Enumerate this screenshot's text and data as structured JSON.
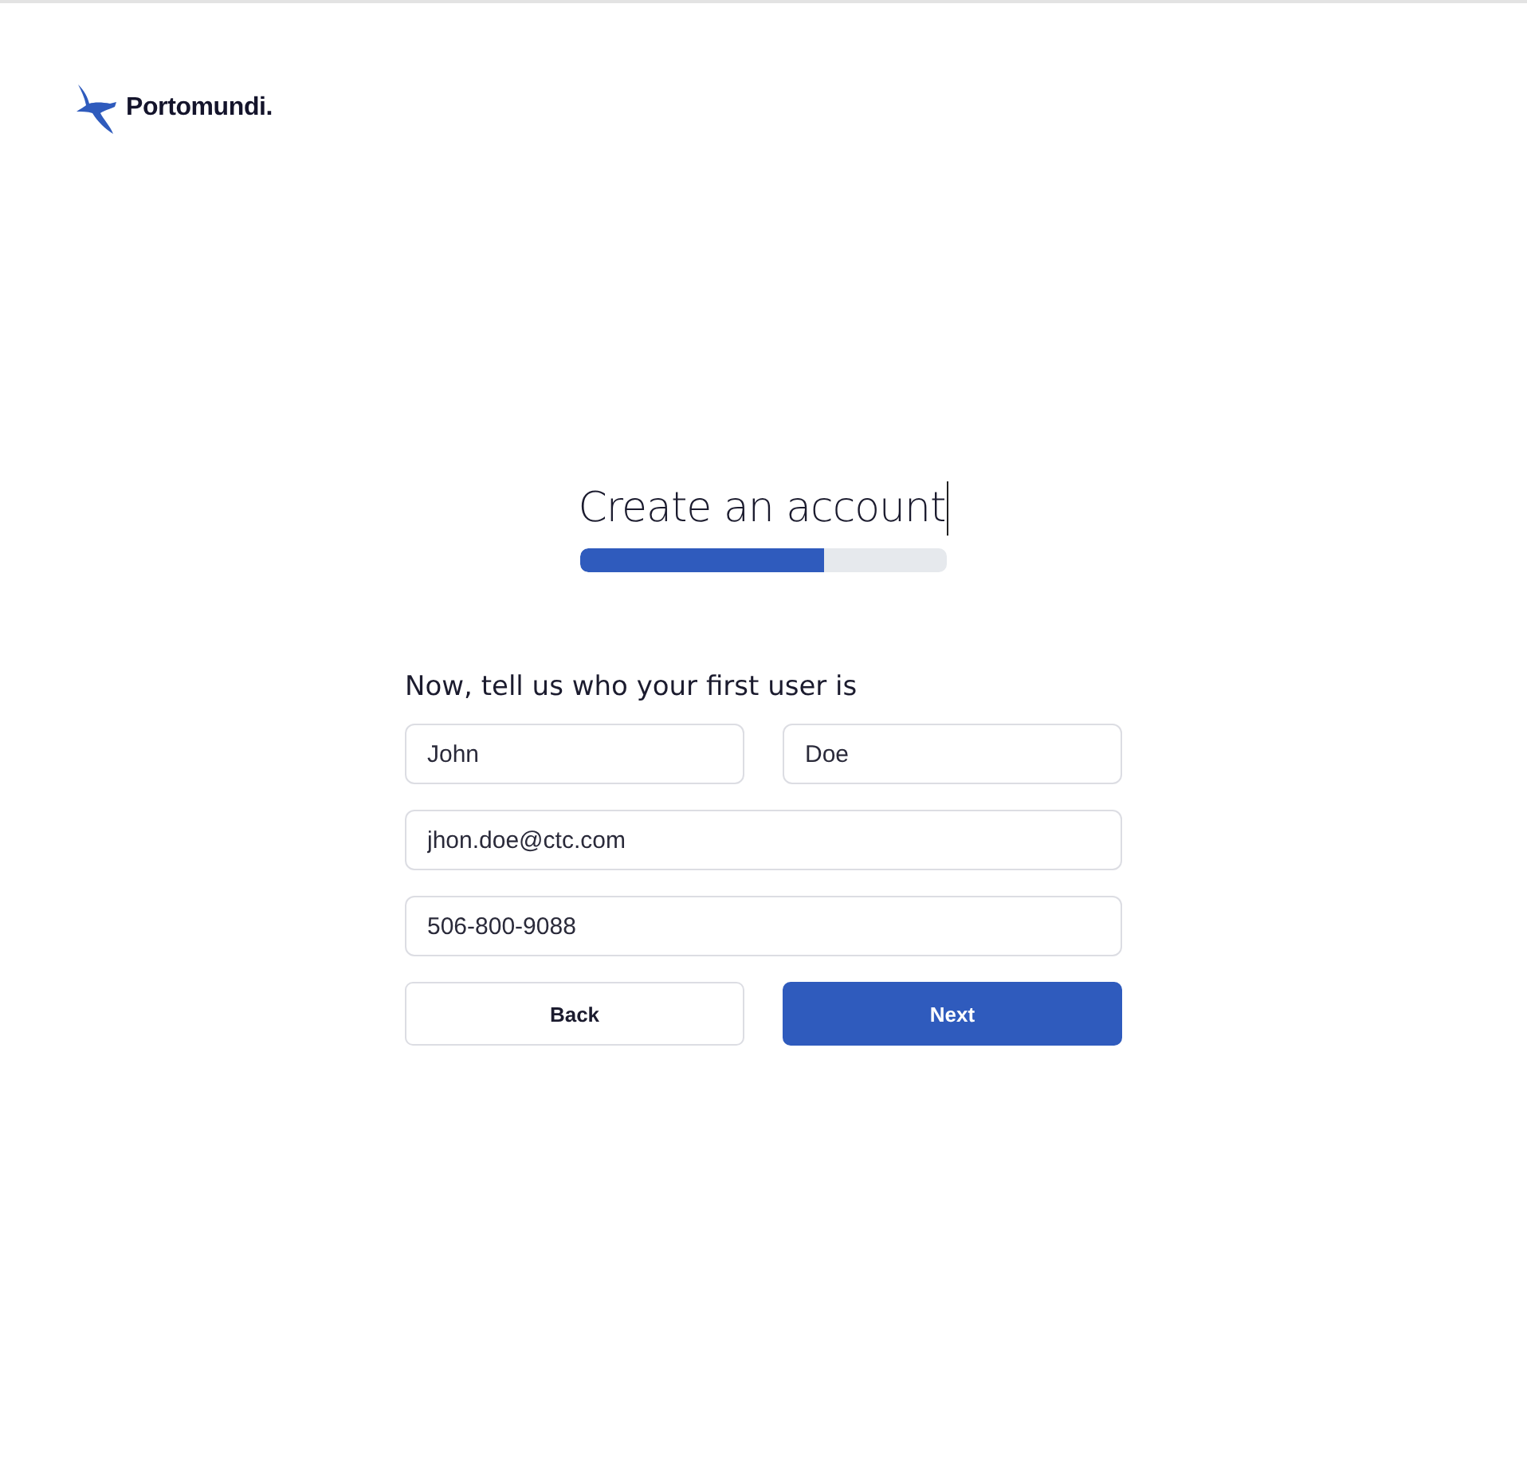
{
  "brand": {
    "name": "Portomundi."
  },
  "heading": {
    "title": "Create an account",
    "progress": {
      "level": 0.665
    }
  },
  "form": {
    "prompt": "Now, tell us who your first user is",
    "rows": [
      [
        {
          "value": "John"
        },
        {
          "value": "Doe"
        }
      ],
      [
        {
          "value": "jhon.doe@ctc.com"
        }
      ],
      [
        {
          "value": "506-800-9088"
        }
      ]
    ],
    "buttons": [
      {
        "label": "Back",
        "kind": "secondary"
      },
      {
        "label": "Next",
        "kind": "primary"
      }
    ]
  }
}
